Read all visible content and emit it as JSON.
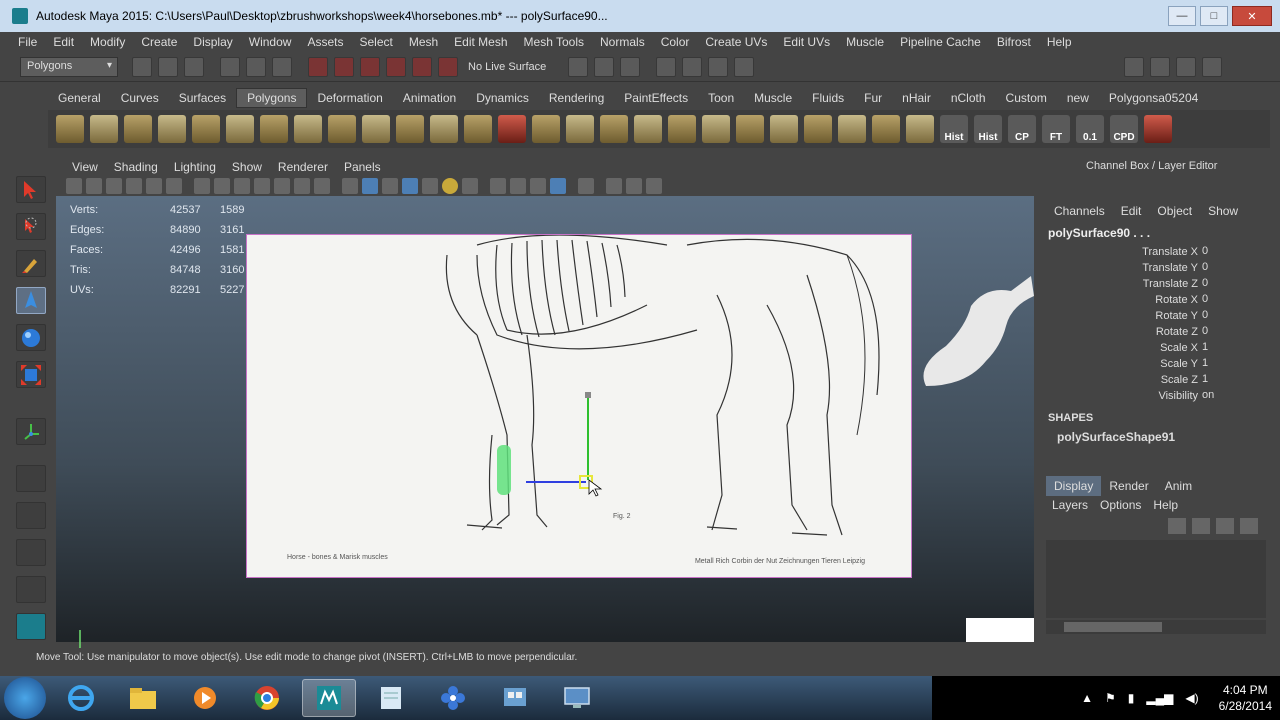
{
  "window": {
    "title": "Autodesk Maya 2015: C:\\Users\\Paul\\Desktop\\zbrushworkshops\\week4\\horsebones.mb*   ---   polySurface90...",
    "minimize": "—",
    "maximize": "□",
    "close": "✕"
  },
  "menubar": [
    "File",
    "Edit",
    "Modify",
    "Create",
    "Display",
    "Window",
    "Assets",
    "Select",
    "Mesh",
    "Edit Mesh",
    "Mesh Tools",
    "Normals",
    "Color",
    "Create UVs",
    "Edit UVs",
    "Muscle",
    "Pipeline Cache",
    "Bifrost",
    "Help"
  ],
  "statusline": {
    "mode": "Polygons",
    "live_surface": "No Live Surface"
  },
  "shelf": {
    "tabs": [
      "General",
      "Curves",
      "Surfaces",
      "Polygons",
      "Deformation",
      "Animation",
      "Dynamics",
      "Rendering",
      "PaintEffects",
      "Toon",
      "Muscle",
      "Fluids",
      "Fur",
      "nHair",
      "nCloth",
      "Custom",
      "new",
      "Polygonsa05204"
    ],
    "active_tab": "Polygons",
    "text_icons": [
      "Hist",
      "Hist",
      "CP",
      "FT",
      "0.1",
      "CPD"
    ]
  },
  "panel": {
    "menus": [
      "View",
      "Shading",
      "Lighting",
      "Show",
      "Renderer",
      "Panels"
    ]
  },
  "hud": {
    "rows": [
      {
        "label": "Verts:",
        "v1": "42537",
        "v2": "1589"
      },
      {
        "label": "Edges:",
        "v1": "84890",
        "v2": "3161"
      },
      {
        "label": "Faces:",
        "v1": "42496",
        "v2": "1581"
      },
      {
        "label": "Tris:",
        "v1": "84748",
        "v2": "3160"
      },
      {
        "label": "UVs:",
        "v1": "82291",
        "v2": "5227"
      }
    ]
  },
  "image_plane": {
    "caption_left": "Horse - bones & Marisk muscles",
    "caption_right": "Metall Rich Corbin der Nut Zeichnungen Tieren Leipzig",
    "figure_label": "Fig. 2"
  },
  "channel_box": {
    "title": "Channel Box / Layer Editor",
    "menus": [
      "Channels",
      "Edit",
      "Object",
      "Show"
    ],
    "object": "polySurface90 . . .",
    "attributes": [
      {
        "name": "Translate X",
        "value": "0"
      },
      {
        "name": "Translate Y",
        "value": "0"
      },
      {
        "name": "Translate Z",
        "value": "0"
      },
      {
        "name": "Rotate X",
        "value": "0"
      },
      {
        "name": "Rotate Y",
        "value": "0"
      },
      {
        "name": "Rotate Z",
        "value": "0"
      },
      {
        "name": "Scale X",
        "value": "1"
      },
      {
        "name": "Scale Y",
        "value": "1"
      },
      {
        "name": "Scale Z",
        "value": "1"
      },
      {
        "name": "Visibility",
        "value": "on"
      }
    ],
    "shapes_heading": "SHAPES",
    "shape_item": "polySurfaceShape91"
  },
  "layer_editor": {
    "tabs": [
      "Display",
      "Render",
      "Anim"
    ],
    "active_tab": "Display",
    "menus": [
      "Layers",
      "Options",
      "Help"
    ]
  },
  "help_line": "Move Tool: Use manipulator to move object(s). Use edit mode to change pivot (INSERT). Ctrl+LMB to move perpendicular.",
  "taskbar": {
    "time": "4:04 PM",
    "date": "6/28/2014",
    "apps": [
      "internet-explorer-icon",
      "file-explorer-icon",
      "media-player-icon",
      "chrome-icon",
      "maya-icon",
      "notepad-icon",
      "flower-app-icon",
      "control-panel-icon",
      "display-icon"
    ]
  },
  "colors": {
    "accent": "#5d6d80",
    "titlebar": "#c9dcef",
    "manip_y": "#2ec02e",
    "manip_x": "#2f3fe0",
    "manip_center": "#e6e63a"
  }
}
